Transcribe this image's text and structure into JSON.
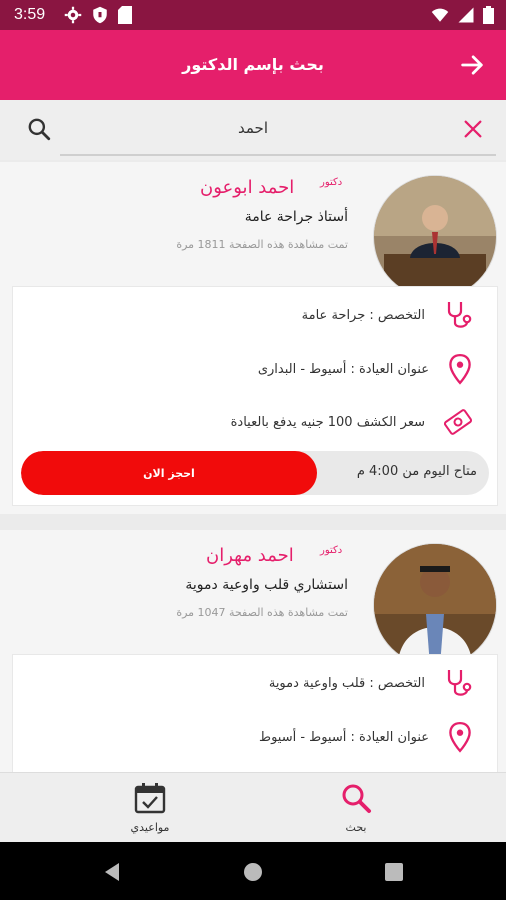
{
  "status": {
    "time": "3:59"
  },
  "header": {
    "title": "بحث بإسم الدكتور"
  },
  "search": {
    "query": "احمد"
  },
  "doctors": [
    {
      "label": "دكتور",
      "name": "احمد ابوعون",
      "title": "أستاذ جراحة عامة",
      "views": "تمت مشاهدة هذه الصفحة 1811 مرة",
      "specialty": "التخصص : جراحة عامة",
      "address": "عنوان العيادة : أسيوط - البدارى",
      "price": "سعر الكشف 100 جنيه يدفع بالعيادة",
      "availability": "متاح اليوم من 4:00 م",
      "book_label": "احجز الان"
    },
    {
      "label": "دكتور",
      "name": "احمد مهران",
      "title": "استشاري قلب واوعية دموية",
      "views": "تمت مشاهدة هذه الصفحة 1047 مرة",
      "specialty": "التخصص : قلب واوعية دموية",
      "address": "عنوان العيادة : أسيوط - أسيوط"
    }
  ],
  "nav": {
    "appointments": "مواعيدي",
    "search": "بحث"
  },
  "colors": {
    "primary": "#e51f6b",
    "status": "#8a1541",
    "book": "#f10b0b"
  }
}
